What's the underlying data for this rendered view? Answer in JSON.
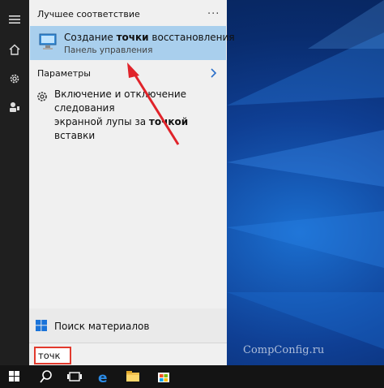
{
  "start_menu": {
    "best_match_header": "Лучшее соответствие",
    "more_label": "...",
    "best_match": {
      "title_prefix": "Создание ",
      "title_bold": "точки",
      "title_suffix": " восстановления",
      "subtitle": "Панель управления"
    },
    "settings_header": "Параметры",
    "settings_item": {
      "line1": "Включение и отключение следования",
      "line2_prefix": "экранной лупы за ",
      "line2_bold": "точкой",
      "line2_suffix": " вставки"
    },
    "store_search_label": "Поиск материалов",
    "search_value": "точк"
  },
  "watermark": "CompConfig.ru",
  "colors": {
    "accent_highlight": "#a9cfed",
    "search_box_border": "#e23a2d",
    "annotation_arrow": "#e0232a"
  },
  "icons": [
    "hamburger-icon",
    "home-icon",
    "gear-icon",
    "user-icon",
    "monitor-icon",
    "settings-gear-icon",
    "chevron-right-icon",
    "windows-logo-icon",
    "search-icon",
    "task-view-icon",
    "edge-icon",
    "explorer-icon",
    "store-icon"
  ]
}
